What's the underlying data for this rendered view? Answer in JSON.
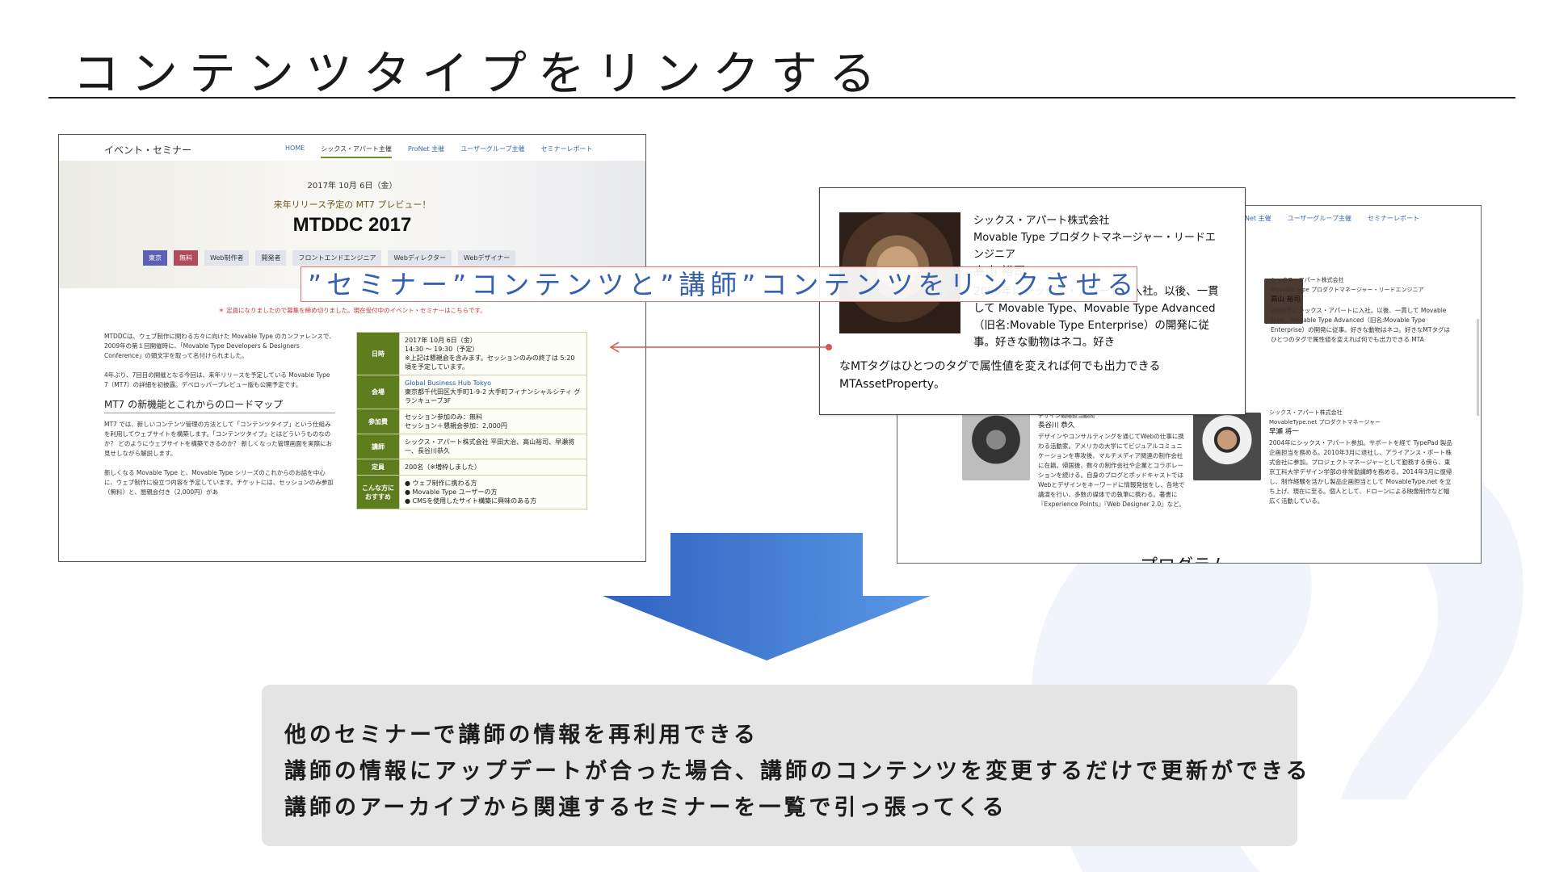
{
  "slide": {
    "title": "コンテンツタイプをリンクする"
  },
  "page_left": {
    "site_title": "イベント・セミナー",
    "nav": [
      "HOME",
      "シックス・アパート主催",
      "ProNet 主催",
      "ユーザーグループ主催",
      "セミナーレポート"
    ],
    "nav_active_index": 1,
    "event_date": "2017年 10月 6日（金）",
    "lead": "来年リリース予定の MT7 プレビュー！",
    "event_title": "MTDDC 2017",
    "tags": [
      "東京",
      "無料",
      "Web制作者",
      "開発者",
      "フロントエンドエンジニア",
      "Webディレクター",
      "Webデザイナー"
    ],
    "notice": "＊ 定員になりましたので募集を締め切りました。現在受付中のイベント・セミナーはこちらです。",
    "paragraph_1": "MTDDCは、ウェブ制作に関わる方々に向けた Movable Type のカンファレンスで、2009年の第１回開催時に、「Movable Type Developers & Designers Conference」の頭文字を取って名付けられました。",
    "paragraph_2": "4年ぶり、7回目の開催となる今回は、来年リリースを予定している Movable Type 7（MT7）の詳細を初披露。デベロッパープレビュー版も公開予定です。",
    "section_heading": "MT7 の新機能とこれからのロードマップ",
    "paragraph_3": "MT7 では、新しいコンテンツ管理の方法として「コンテンツタイプ」という仕組みを利用してウェブサイトを構築します。「コンテンツタイプ」とはどういうものなのか？ どのようにウェブサイトを構築できるのか？ 新しくなった管理画面を実際にお見せしながら解説します。",
    "paragraph_4": "新しくなる Movable Type と、Movable Type シリーズのこれからのお話を中心に、ウェブ制作に役立つ内容を予定しています。チケットには、セッションのみ参加（無料）と、懇親会付き（2,000円）があ",
    "table": [
      {
        "label": "日時",
        "lines": [
          "2017年 10月 6日（金）",
          "14:30 〜 19:30（予定）",
          "※上記は懇親会を含みます。セッションのみの終了は 5:20 頃を予定しています。"
        ]
      },
      {
        "label": "会場",
        "lines": [
          "Global Business Hub Tokyo",
          "東京都千代田区大手町1-9-2 大手町フィナンシャルシティ グランキューブ3F"
        ]
      },
      {
        "label": "参加費",
        "lines": [
          "セッション参加のみ：無料",
          "セッション＋懇親会参加：2,000円"
        ]
      },
      {
        "label": "講師",
        "lines": [
          "シックス・アパート株式会社 平田大治、高山裕司、早瀬将一、長谷川恭久"
        ]
      },
      {
        "label": "定員",
        "lines": [
          "200名（※増枠しました）"
        ]
      },
      {
        "label": "こんな方におすすめ",
        "lines": [
          "● ウェブ制作に携わる方",
          "● Movable Type ユーザーの方",
          "● CMSを使用したサイト構築に興味のある方"
        ]
      }
    ]
  },
  "page_right": {
    "nav": [
      "Net 主催",
      "ユーザーグループ主催",
      "セミナーレポート"
    ],
    "person_1": {
      "company": "シックス・アパート株式会社",
      "role": "Movable Type プロダクトマネージャー・リードエンジニア",
      "name": "高山 裕司",
      "bio": "2006年にシックス・アパートに入社。以後、一貫して Movable Type、Movable Type Advanced（旧名:Movable Type Enterprise）の開発に従事。好きな動物はネコ。好きなMTタグはひとつのタグで属性値を変えれば何でも出力できる MTA"
    },
    "person_2": {
      "role": "デザイン戦略担当顧問",
      "name": "長谷川 恭久",
      "bio": "デザインやコンサルティングを通じてWebの仕事に携わる活動家。アメリカの大学にてビジュアルコミュニケーションを専攻後、マルチメディア関連の制作会社に在籍。帰国後、数々の制作会社や企業とコラボレーションを続ける。自身のブログとポッドキャストではWebとデザインをキーワードに情報発信をし、各地で講演を行い、多数の媒体での執筆に携わる。著書に『Experience Points』『Web Designer 2.0』など。"
    },
    "person_3": {
      "company": "シックス・アパート株式会社",
      "role": "MovableType.net プロダクトマネージャー",
      "name": "早瀬 将一",
      "bio": "2004年にシックス・アパート参加。サポートを経て TypePad 製品企画担当を務める。2010年3月に退社し、アライアンス・ポート株式会社に参加。プロジェクトマネージャーとして勤務する傍ら、東京工科大学デザイン学部の非常勤講師を務める。2014年3月に復帰し、制作経験を活かし製品企画担当として MovableType.net を立ち上げ、現在に至る。個人として、ドローンによる映像制作など幅広く活動している。"
    },
    "footer_heading": "プログラム"
  },
  "popup": {
    "company": "シックス・アパート株式会社",
    "role": "Movable Type プロダクトマネージャー・リードエンジニア",
    "name": "高山 裕司",
    "bio": "2006年にシックス・アパートに入社。以後、一貫して Movable Type、Movable Type Advanced（旧名:Movable Type Enterprise）の開発に従事。好きな動物はネコ。好き",
    "bio_continued": "なMTタグはひとつのタグで属性値を変えれば何でも出力できる MTAssetProperty。"
  },
  "annotation": {
    "link_text": "”セミナー”コンテンツと”講師”コンテンツをリンクさせる"
  },
  "summary": {
    "items": [
      "他のセミナーで講師の情報を再利用できる",
      "講師の情報にアップデートが合った場合、講師のコンテンツを変更するだけで更新ができる",
      "講師のアーカイブから関連するセミナーを一覧で引っ張ってくる"
    ]
  },
  "colors": {
    "arrow_start": "#2f62c0",
    "arrow_end": "#5a98e6",
    "link_label_text": "#3560b0",
    "link_line": "#d9534f",
    "table_header": "#5e7d1f",
    "summary_bg": "#e4e4e4"
  }
}
